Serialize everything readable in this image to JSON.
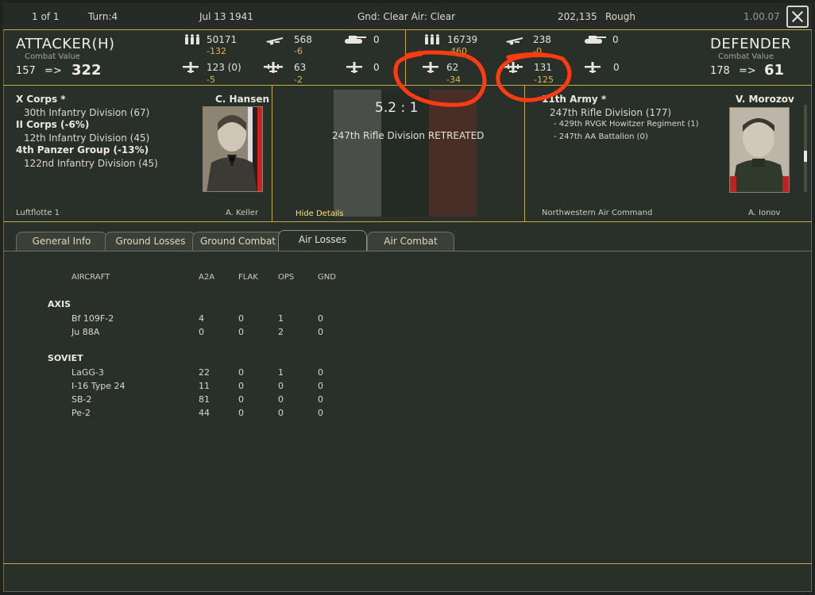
{
  "topbar": {
    "page": "1 of 1",
    "turn": "Turn:4",
    "date": "Jul 13 1941",
    "weather": "Gnd: Clear   Air: Clear",
    "hex": "202,135",
    "terrain": "Rough",
    "version": "1.00.07"
  },
  "attacker": {
    "title": "ATTACKER(H)",
    "cv_label": "Combat Value",
    "cv_from": "157",
    "arrow": "=>",
    "cv_to": "322",
    "men": "50171",
    "men_loss": "-132",
    "guns": "568",
    "guns_loss": "-6",
    "afv": "0",
    "fighters": "123 (0)",
    "fighters_loss": "-5",
    "bombers": "63",
    "bombers_loss": "-2",
    "recon": "0",
    "hq": "X Corps *",
    "commander": "C. Hansen",
    "units": [
      {
        "name": "30th Infantry Division (67)",
        "bold": false,
        "indent": 1
      },
      {
        "name": "II Corps (-6%)",
        "bold": true,
        "indent": 0
      },
      {
        "name": "12th Infantry Division (45)",
        "bold": false,
        "indent": 1
      },
      {
        "name": "4th Panzer Group (-13%)",
        "bold": true,
        "indent": 0
      },
      {
        "name": "122nd Infantry Division (45)",
        "bold": false,
        "indent": 1
      }
    ],
    "air_hq": "Luftflotte 1",
    "air_commander": "A. Keller"
  },
  "defender": {
    "title": "DEFENDER",
    "cv_label": "Combat Value",
    "cv_from": "178",
    "arrow": "=>",
    "cv_to": "61",
    "men": "16739",
    "men_loss": "-460",
    "guns": "238",
    "guns_loss": "-0",
    "afv": "0",
    "fighters": "62",
    "fighters_loss": "-34",
    "bombers": "131",
    "bombers_loss": "-125",
    "recon": "0",
    "hq": "11th Army *",
    "commander": "V. Morozov",
    "units": [
      {
        "name": "247th Rifle Division (177)",
        "bold": false
      },
      {
        "name": "- 429th RVGK Howitzer Regiment (1)",
        "bold": false,
        "small": true
      },
      {
        "name": "- 247th AA Battalion (0)",
        "bold": false,
        "small": true
      }
    ],
    "air_hq": "Northwestern Air Command",
    "air_commander": "A. Ionov"
  },
  "battle": {
    "ratio": "5.2 : 1",
    "result": "247th Rifle Division RETREATED",
    "hide_details": "Hide Details"
  },
  "tabs": [
    "General Info",
    "Ground Losses",
    "Ground Combat",
    "Air Losses",
    "Air Combat"
  ],
  "active_tab": "Air Losses",
  "air_losses": {
    "headers": [
      "AIRCRAFT",
      "A2A",
      "FLAK",
      "OPS",
      "GND"
    ],
    "groups": [
      {
        "name": "AXIS",
        "rows": [
          {
            "aircraft": "Bf 109F-2",
            "a2a": "4",
            "flak": "0",
            "ops": "1",
            "gnd": "0"
          },
          {
            "aircraft": "Ju 88A",
            "a2a": "0",
            "flak": "0",
            "ops": "2",
            "gnd": "0"
          }
        ]
      },
      {
        "name": "SOVIET",
        "rows": [
          {
            "aircraft": "LaGG-3",
            "a2a": "22",
            "flak": "0",
            "ops": "1",
            "gnd": "0"
          },
          {
            "aircraft": "I-16 Type 24",
            "a2a": "11",
            "flak": "0",
            "ops": "0",
            "gnd": "0"
          },
          {
            "aircraft": "SB-2",
            "a2a": "81",
            "flak": "0",
            "ops": "0",
            "gnd": "0"
          },
          {
            "aircraft": "Pe-2",
            "a2a": "44",
            "flak": "0",
            "ops": "0",
            "gnd": "0"
          }
        ]
      }
    ]
  },
  "colors": {
    "accent": "#c7a747",
    "loss": "#e3b447",
    "annotation": "#ff3b12",
    "background": "#293029"
  },
  "icons": [
    "infantry-icon",
    "artillery-icon",
    "tank-icon",
    "fighter-icon",
    "bomber-icon",
    "recon-plane-icon",
    "close-icon"
  ]
}
